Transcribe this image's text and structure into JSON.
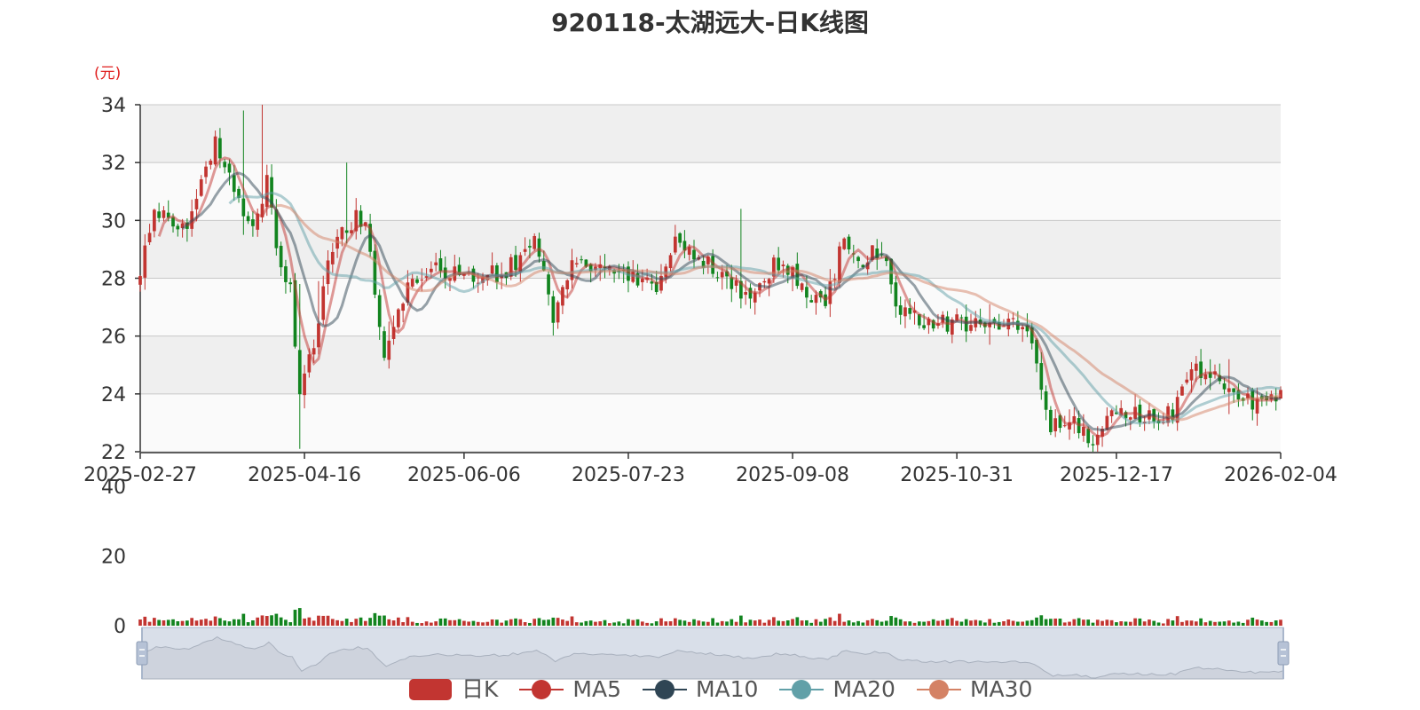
{
  "title": "920118-太湖远大-日K线图",
  "colors": {
    "up": "#c23531",
    "down": "#12841f",
    "ma5": "#c23531",
    "ma10": "#2f4554",
    "ma20": "#61a0a8",
    "ma30": "#d48265",
    "grid_band": "#efefef",
    "grid_line": "#c8c8c8",
    "axis": "#333333",
    "slider_bg": "#d9dfe9",
    "slider_border": "#a9b6cb"
  },
  "chart_data": {
    "type": "candlestick",
    "title": "920118-太湖远大-日K线图",
    "ylabel": "(元)",
    "ylim": [
      22,
      34
    ],
    "yticks": [
      22,
      24,
      26,
      28,
      30,
      32,
      34
    ],
    "xticks": [
      "2025-02-27",
      "2025-04-16",
      "2025-06-06",
      "2025-07-23",
      "2025-09-08",
      "2025-10-31",
      "2025-12-17",
      "2026-02-04"
    ],
    "volume_ylim": [
      0,
      40
    ],
    "volume_yticks": [
      0,
      20,
      40
    ],
    "legend": [
      "日K",
      "MA5",
      "MA10",
      "MA20",
      "MA30"
    ],
    "close_keypoints": [
      [
        0,
        28.2
      ],
      [
        3,
        30.5
      ],
      [
        8,
        29.5
      ],
      [
        12,
        30.6
      ],
      [
        16,
        32.8
      ],
      [
        20,
        31.0
      ],
      [
        24,
        29.5
      ],
      [
        27,
        31.6
      ],
      [
        29,
        28.9
      ],
      [
        32,
        27.7
      ],
      [
        34,
        24.0
      ],
      [
        37,
        25.6
      ],
      [
        40,
        28.3
      ],
      [
        44,
        29.9
      ],
      [
        48,
        30.2
      ],
      [
        52,
        25.2
      ],
      [
        55,
        27.2
      ],
      [
        60,
        28.2
      ],
      [
        66,
        28.2
      ],
      [
        72,
        28.0
      ],
      [
        78,
        28.2
      ],
      [
        84,
        29.4
      ],
      [
        88,
        26.6
      ],
      [
        92,
        28.6
      ],
      [
        98,
        28.2
      ],
      [
        104,
        28.1
      ],
      [
        110,
        27.7
      ],
      [
        114,
        29.3
      ],
      [
        118,
        28.9
      ],
      [
        124,
        28.0
      ],
      [
        130,
        27.2
      ],
      [
        136,
        28.6
      ],
      [
        142,
        27.6
      ],
      [
        146,
        27.2
      ],
      [
        150,
        29.3
      ],
      [
        154,
        28.7
      ],
      [
        158,
        28.9
      ],
      [
        162,
        26.7
      ],
      [
        168,
        26.4
      ],
      [
        174,
        26.5
      ],
      [
        180,
        26.5
      ],
      [
        186,
        26.3
      ],
      [
        190,
        25.7
      ],
      [
        194,
        22.8
      ],
      [
        198,
        23.0
      ],
      [
        204,
        22.4
      ],
      [
        208,
        23.4
      ],
      [
        213,
        23.3
      ],
      [
        217,
        22.9
      ],
      [
        220,
        23.4
      ],
      [
        224,
        24.9
      ],
      [
        228,
        24.8
      ],
      [
        232,
        24.2
      ],
      [
        236,
        23.8
      ],
      [
        240,
        23.6
      ],
      [
        243,
        23.9
      ]
    ],
    "spikes": [
      {
        "index": 22,
        "low": 29.5,
        "high": 33.8
      },
      {
        "index": 26,
        "low": 30.5,
        "high": 34.0
      },
      {
        "index": 34,
        "low": 22.1,
        "high": 27.8
      },
      {
        "index": 35,
        "low": 23.5,
        "high": 25.0
      },
      {
        "index": 38,
        "low": 26.0,
        "high": 27.9
      },
      {
        "index": 44,
        "low": 29.2,
        "high": 32.0
      },
      {
        "index": 53,
        "low": 25.0,
        "high": 26.5
      },
      {
        "index": 128,
        "low": 28.3,
        "high": 30.4
      },
      {
        "index": 181,
        "low": 25.7,
        "high": 27.1
      },
      {
        "index": 232,
        "low": 23.3,
        "high": 25.2
      }
    ],
    "series": [
      {
        "name": "日K"
      },
      {
        "name": "MA5",
        "period": 5
      },
      {
        "name": "MA10",
        "period": 10
      },
      {
        "name": "MA20",
        "period": 20
      },
      {
        "name": "MA30",
        "period": 30
      }
    ]
  }
}
